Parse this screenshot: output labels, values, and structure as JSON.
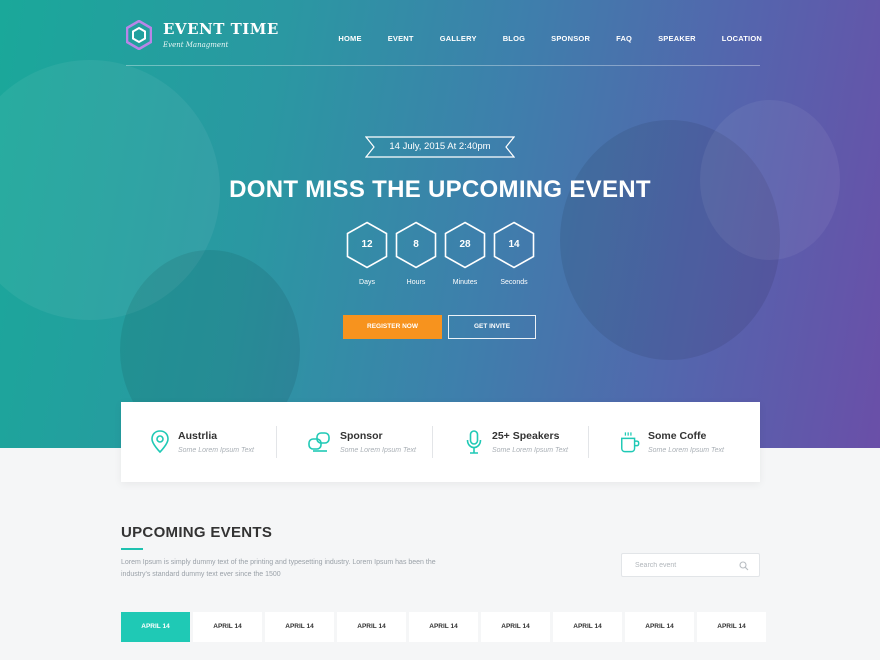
{
  "brand": {
    "title": "EVENT TIME",
    "subtitle": "Event Managment"
  },
  "nav": [
    "HOME",
    "EVENT",
    "GALLERY",
    "BLOG",
    "SPONSOR",
    "FAQ",
    "SPEAKER",
    "LOCATION"
  ],
  "hero": {
    "date": "14 July, 2015 At 2:40pm",
    "headline": "DONT MISS THE UPCOMING EVENT",
    "countdown": [
      {
        "value": "12",
        "label": "Days"
      },
      {
        "value": "8",
        "label": "Hours"
      },
      {
        "value": "28",
        "label": "Minutes"
      },
      {
        "value": "14",
        "label": "Seconds"
      }
    ],
    "register_label": "REGISTER NOW",
    "invite_label": "GET INVITE"
  },
  "info": [
    {
      "title": "Austrlia",
      "sub": "Some Lorem Ipsum Text",
      "icon": "map-pin-icon"
    },
    {
      "title": "Sponsor",
      "sub": "Some Lorem Ipsum Text",
      "icon": "handshake-icon"
    },
    {
      "title": "25+ Speakers",
      "sub": "Some Lorem Ipsum Text",
      "icon": "microphone-icon"
    },
    {
      "title": "Some Coffe",
      "sub": "Some Lorem Ipsum Text",
      "icon": "coffee-cup-icon"
    }
  ],
  "upcoming": {
    "title": "UPCOMING EVENTS",
    "description": "Lorem Ipsum is simply dummy text of the printing and typesetting industry. Lorem Ipsum has been the industry's standard dummy text ever since the 1500",
    "search_placeholder": "Search event"
  },
  "tabs": [
    "APRIL 14",
    "APRIL 14",
    "APRIL 14",
    "APRIL 14",
    "APRIL 14",
    "APRIL 14",
    "APRIL 14",
    "APRIL 14",
    "APRIL 14"
  ],
  "colors": {
    "accent": "#1fc9b5",
    "orange": "#f7931e"
  }
}
